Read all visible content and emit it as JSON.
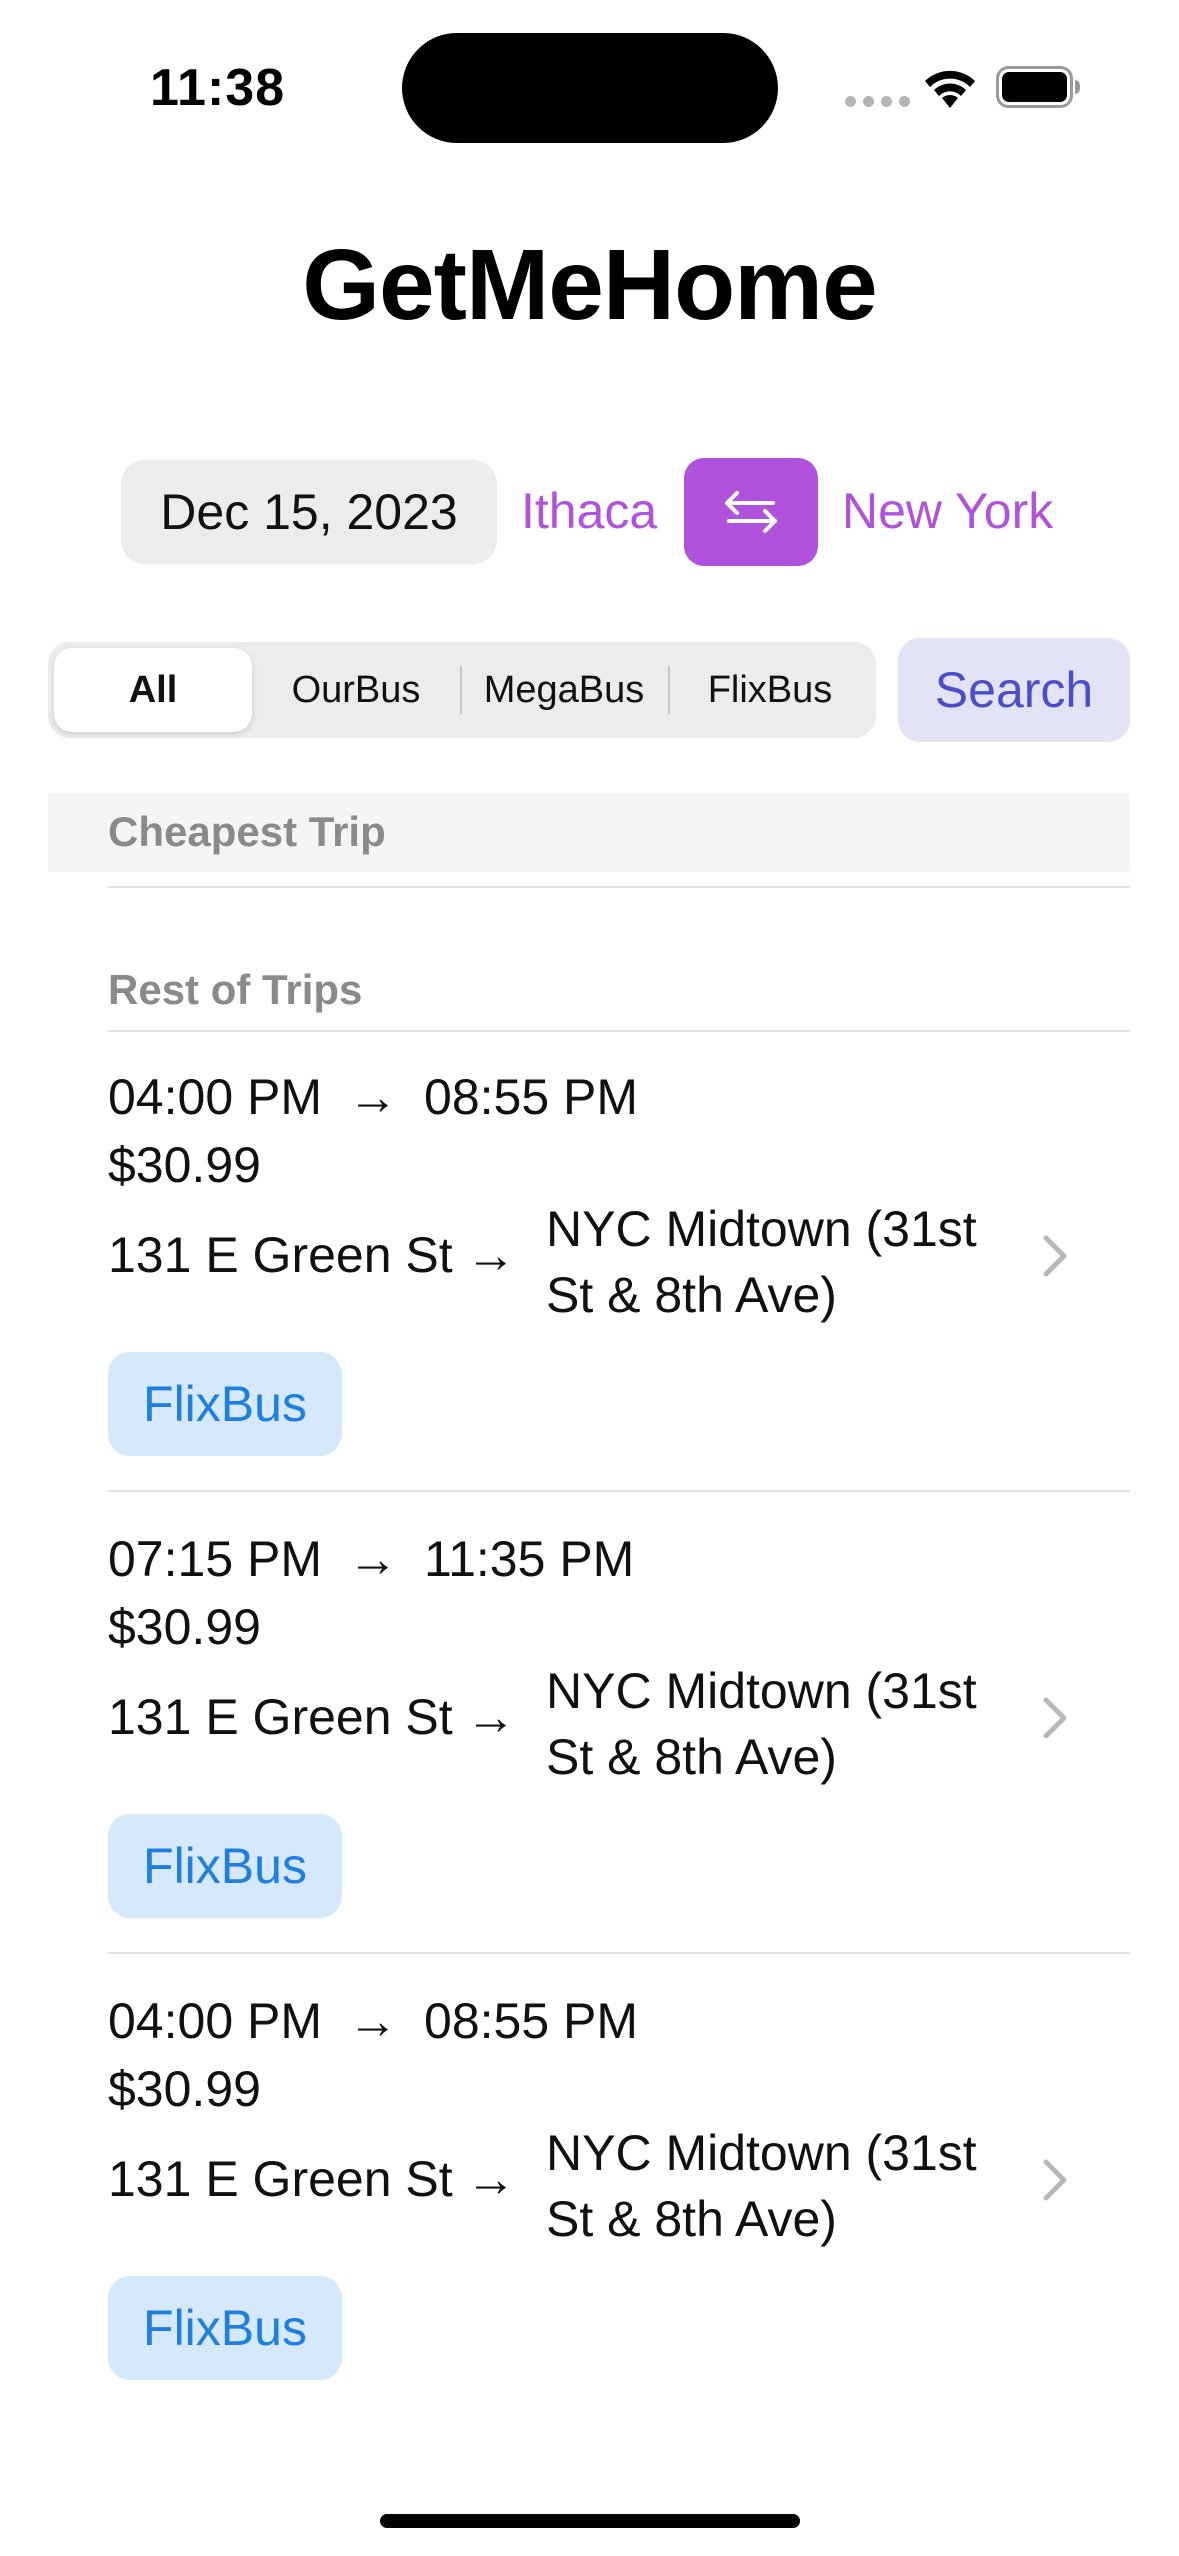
{
  "status_bar": {
    "time": "11:38"
  },
  "app": {
    "title": "GetMeHome"
  },
  "route": {
    "date": "Dec 15, 2023",
    "origin": "Ithaca",
    "destination": "New York",
    "accent_color": "#b052dc"
  },
  "filters": {
    "segments": [
      "All",
      "OurBus",
      "MegaBus",
      "FlixBus"
    ],
    "selected": "All",
    "search_label": "Search"
  },
  "sections": {
    "cheapest": "Cheapest Trip",
    "rest": "Rest of Trips"
  },
  "trips": [
    {
      "depart": "04:00 PM",
      "arrive": "08:55 PM",
      "price": "$30.99",
      "from": "131 E Green St",
      "to": "NYC Midtown (31st St & 8th Ave)",
      "operator": "FlixBus"
    },
    {
      "depart": "07:15 PM",
      "arrive": "11:35 PM",
      "price": "$30.99",
      "from": "131 E Green St",
      "to": "NYC Midtown (31st St & 8th Ave)",
      "operator": "FlixBus"
    },
    {
      "depart": "04:00 PM",
      "arrive": "08:55 PM",
      "price": "$30.99",
      "from": "131 E Green St",
      "to": "NYC Midtown (31st St & 8th Ave)",
      "operator": "FlixBus"
    }
  ],
  "icons": {
    "swap": "swap-arrows-icon",
    "chevron": "chevron-right-icon",
    "wifi": "wifi-icon",
    "battery": "battery-icon"
  }
}
